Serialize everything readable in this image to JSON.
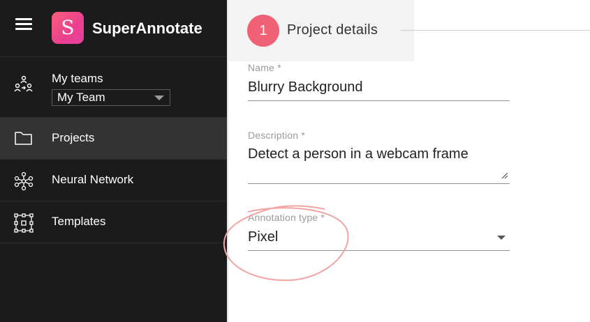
{
  "app": {
    "brand": "SuperAnnotate",
    "logo_letter": "S"
  },
  "sidebar": {
    "teams": {
      "label": "My teams",
      "selected_team": "My Team"
    },
    "items": [
      {
        "label": "Projects",
        "icon": "folder-icon",
        "active": true
      },
      {
        "label": "Neural Network",
        "icon": "neural-network-icon",
        "active": false
      },
      {
        "label": "Templates",
        "icon": "templates-icon",
        "active": false
      }
    ]
  },
  "stepper": {
    "step_number": "1",
    "step_title": "Project details"
  },
  "form": {
    "name": {
      "label": "Name *",
      "value": "Blurry Background"
    },
    "description": {
      "label": "Description *",
      "value": "Detect a person in a webcam frame"
    },
    "annotation_type": {
      "label": "Annotation type *",
      "value": "Pixel"
    }
  },
  "colors": {
    "sidebar_bg": "#1b1b1b",
    "active_item_bg": "#333333",
    "accent": "#f06176",
    "highlight_scribble": "#f0a0a0"
  }
}
